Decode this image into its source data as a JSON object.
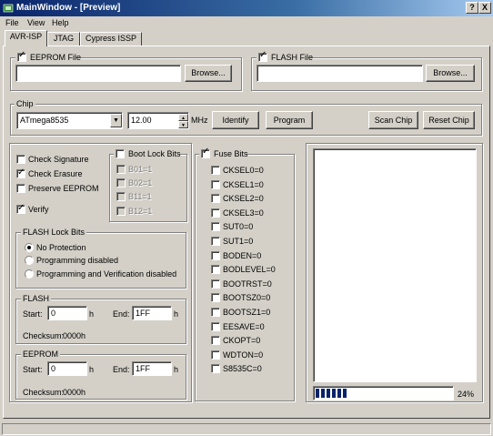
{
  "window": {
    "title": "MainWindow - [Preview]",
    "help_btn": "?",
    "close_btn": "X"
  },
  "menu": [
    "File",
    "View",
    "Help"
  ],
  "tabs": [
    "AVR-ISP",
    "JTAG",
    "Cypress ISSP"
  ],
  "eeprom_file": {
    "label": "EEPROM File",
    "checked": true,
    "value": "",
    "browse": "Browse..."
  },
  "flash_file": {
    "label": "FLASH File",
    "checked": true,
    "value": "",
    "browse": "Browse..."
  },
  "chip": {
    "label": "Chip",
    "selected": "ATmega8535",
    "frequency": "12.00",
    "freq_unit": "MHz",
    "identify": "Identify",
    "program": "Program",
    "scan": "Scan Chip",
    "reset": "Reset Chip"
  },
  "options": {
    "check_signature": "Check Signature",
    "check_erasure": "Check Erasure",
    "preserve_eeprom": "Preserve EEPROM",
    "verify": "Verify"
  },
  "boot_lock": {
    "label": "Boot Lock Bits",
    "items": [
      "B01=1",
      "B02=1",
      "B11=1",
      "B12=1"
    ]
  },
  "flash_lock": {
    "label": "FLASH Lock Bits",
    "options": [
      "No Protection",
      "Programming disabled",
      "Programming and Verification disabled"
    ],
    "selected": 0
  },
  "flash": {
    "label": "FLASH",
    "start_label": "Start:",
    "start": "0",
    "end_label": "End:",
    "end": "1FF",
    "unit": "h",
    "checksum_label": "Checksum:",
    "checksum": "0000h"
  },
  "eeprom": {
    "label": "EEPROM",
    "start_label": "Start:",
    "start": "0",
    "end_label": "End:",
    "end": "1FF",
    "unit": "h",
    "checksum_label": "Checksum:",
    "checksum": "0000h"
  },
  "fuse_bits": {
    "label": "Fuse Bits",
    "items": [
      "CKSEL0=0",
      "CKSEL1=0",
      "CKSEL2=0",
      "CKSEL3=0",
      "SUT0=0",
      "SUT1=0",
      "BODEN=0",
      "BODLEVEL=0",
      "BOOTRST=0",
      "BOOTSZ0=0",
      "BOOTSZ1=0",
      "EESAVE=0",
      "CKOPT=0",
      "WDTON=0",
      "S8535C=0"
    ]
  },
  "progress": {
    "value": 0.24,
    "label": "24%"
  },
  "colors": {
    "titlebar": "#0a246a",
    "face": "#d4d0c8",
    "progress": "#0a246a"
  }
}
